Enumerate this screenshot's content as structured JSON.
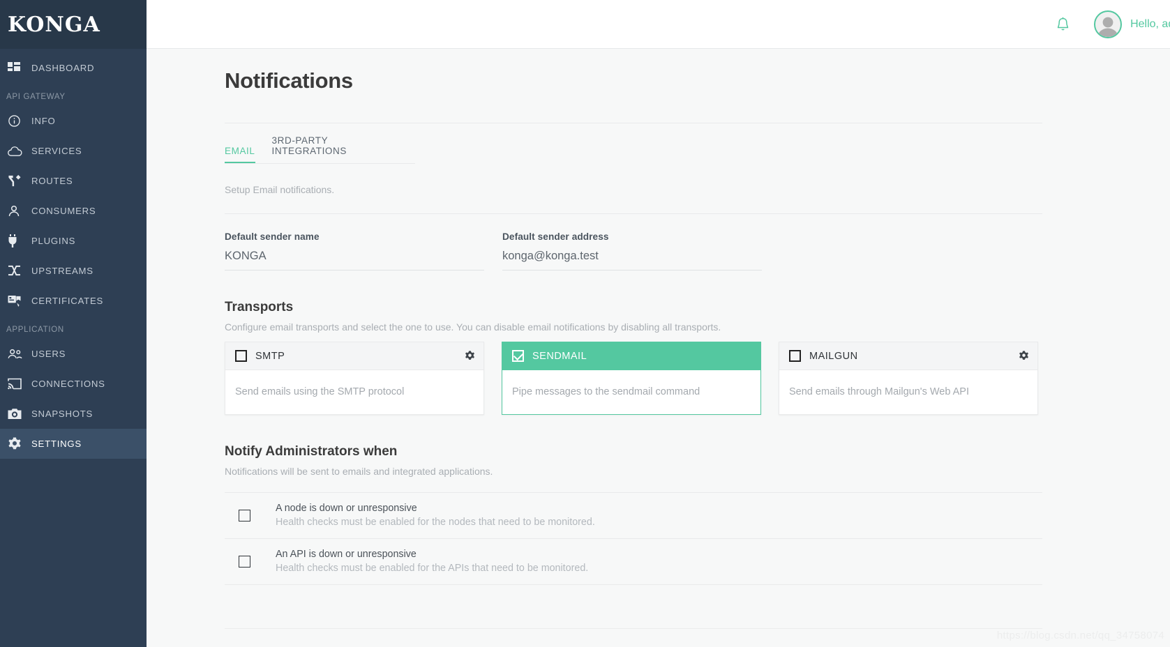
{
  "brand": {
    "name": "KONGA"
  },
  "topbar": {
    "bell_icon": "bell-icon",
    "avatar_icon": "user-avatar-icon",
    "greeting": "Hello, admin"
  },
  "sidebar": {
    "groups": [
      {
        "label": "",
        "items": [
          {
            "label": "DASHBOARD",
            "icon": "dashboard-icon",
            "active": false
          }
        ]
      },
      {
        "label": "API GATEWAY",
        "items": [
          {
            "label": "INFO",
            "icon": "info-icon",
            "active": false
          },
          {
            "label": "SERVICES",
            "icon": "cloud-icon",
            "active": false
          },
          {
            "label": "ROUTES",
            "icon": "routes-icon",
            "active": false
          },
          {
            "label": "CONSUMERS",
            "icon": "user-icon",
            "active": false
          },
          {
            "label": "PLUGINS",
            "icon": "plug-icon",
            "active": false
          },
          {
            "label": "UPSTREAMS",
            "icon": "shuffle-icon",
            "active": false
          },
          {
            "label": "CERTIFICATES",
            "icon": "certificate-icon",
            "active": false
          }
        ]
      },
      {
        "label": "APPLICATION",
        "items": [
          {
            "label": "USERS",
            "icon": "users-icon",
            "active": false
          },
          {
            "label": "CONNECTIONS",
            "icon": "cast-icon",
            "active": false
          },
          {
            "label": "SNAPSHOTS",
            "icon": "camera-icon",
            "active": false
          },
          {
            "label": "SETTINGS",
            "icon": "gear-icon",
            "active": true
          }
        ]
      }
    ]
  },
  "page": {
    "title": "Notifications",
    "tabs": [
      {
        "label": "EMAIL",
        "active": true
      },
      {
        "label": "3RD-PARTY INTEGRATIONS",
        "active": false
      }
    ],
    "setup_note": "Setup Email notifications."
  },
  "form": {
    "sender_name": {
      "label": "Default sender name",
      "value": "KONGA",
      "placeholder": "Default sender name"
    },
    "sender_address": {
      "label": "Default sender address",
      "value": "konga@konga.test",
      "placeholder": "Default sender address"
    }
  },
  "transports": {
    "title": "Transports",
    "description": "Configure email transports and select the one to use. You can disable email notifications by disabling all transports.",
    "cards": [
      {
        "name": "SMTP",
        "description": "Send emails using the SMTP protocol",
        "checked": false,
        "has_gear": true,
        "gear_icon": "gear-icon"
      },
      {
        "name": "SENDMAIL",
        "description": "Pipe messages to the sendmail command",
        "checked": true,
        "has_gear": false,
        "gear_icon": ""
      },
      {
        "name": "MAILGUN",
        "description": "Send emails through Mailgun's Web API",
        "checked": false,
        "has_gear": true,
        "gear_icon": "gear-icon"
      }
    ]
  },
  "notify": {
    "title": "Notify Administrators when",
    "description": "Notifications will be sent to emails and integrated applications.",
    "rows": [
      {
        "title": "A node is down or unresponsive",
        "subtitle": "Health checks must be enabled for the nodes that need to be monitored.",
        "checked": false
      },
      {
        "title": "An API is down or unresponsive",
        "subtitle": "Health checks must be enabled for the APIs that need to be monitored.",
        "checked": false
      }
    ]
  },
  "watermark": {
    "text": "https://blog.csdn.net/qq_34758074"
  },
  "colors": {
    "accent": "#54c8a0",
    "sidebar_bg": "#2e3f54",
    "sidebar_active": "#3b5068",
    "page_bg": "#f7f8f8"
  }
}
